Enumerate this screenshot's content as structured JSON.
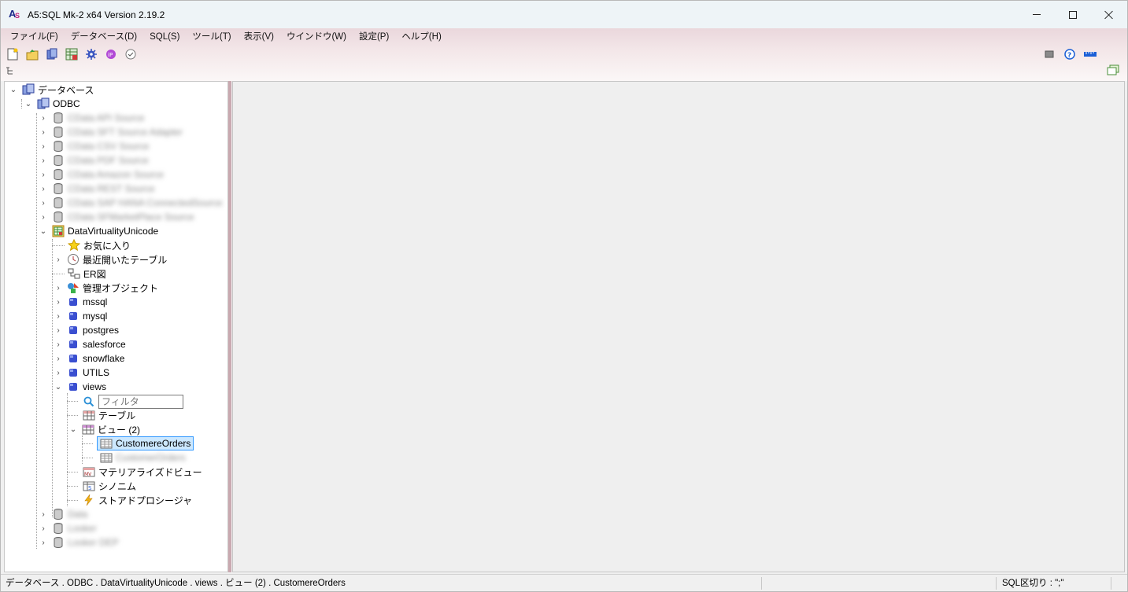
{
  "window": {
    "title": "A5:SQL Mk-2 x64 Version 2.19.2",
    "minimize_icon": "minimize-icon",
    "maximize_icon": "maximize-icon",
    "close_icon": "close-icon"
  },
  "menu": [
    {
      "label": "ファイル(F)"
    },
    {
      "label": "データベース(D)"
    },
    {
      "label": "SQL(S)"
    },
    {
      "label": "ツール(T)"
    },
    {
      "label": "表示(V)"
    },
    {
      "label": "ウインドウ(W)"
    },
    {
      "label": "設定(P)"
    },
    {
      "label": "ヘルプ(H)"
    }
  ],
  "toolbar": {
    "left_icons": [
      "new-sql-icon",
      "open-folder-icon",
      "database-icon",
      "table-editor-icon",
      "settings-gear-icon",
      "plugin-icon",
      "history-icon"
    ],
    "right_icons": [
      "stop-icon",
      "help-icon",
      "ruler-icon"
    ]
  },
  "tree": {
    "root": "データベース",
    "odbc": "ODBC",
    "hidden_sources": [
      "CData API Source",
      "CData SFT Source Adapter",
      "CData CSV Source",
      "CData PDF Source",
      "CData Amazon Source",
      "CData REST Source",
      "CData SAP HANA ConnectedSource",
      "CData SFMarketPlace Source"
    ],
    "datasource": "DataVirtualityUnicode",
    "favorites": "お気に入り",
    "recent": "最近開いたテーブル",
    "er": "ER図",
    "managed": "管理オブジェクト",
    "schemas": [
      "mssql",
      "mysql",
      "postgres",
      "salesforce",
      "snowflake",
      "UTILS"
    ],
    "views_schema": "views",
    "filter_placeholder": "フィルタ",
    "tables": "テーブル",
    "views_node": "ビュー (2)",
    "selected_view": "CustomereOrders",
    "hidden_view": "CustomerOrders",
    "materialized": "マテリアライズドビュー",
    "synonyms": "シノニム",
    "procedures": "ストアドプロシージャ",
    "bottom_hidden": [
      "Data",
      "Looker",
      "Looker DEP"
    ]
  },
  "status": {
    "path": "データベース . ODBC . DataVirtualityUnicode . views . ビュー (2) . CustomereOrders",
    "delimiter": "SQL区切り : \";\""
  },
  "colors": {
    "chrome_pink": "#ead7dc",
    "selection": "#cce8ff",
    "selection_border": "#3399ff",
    "db_blue": "#3a4fd0"
  }
}
